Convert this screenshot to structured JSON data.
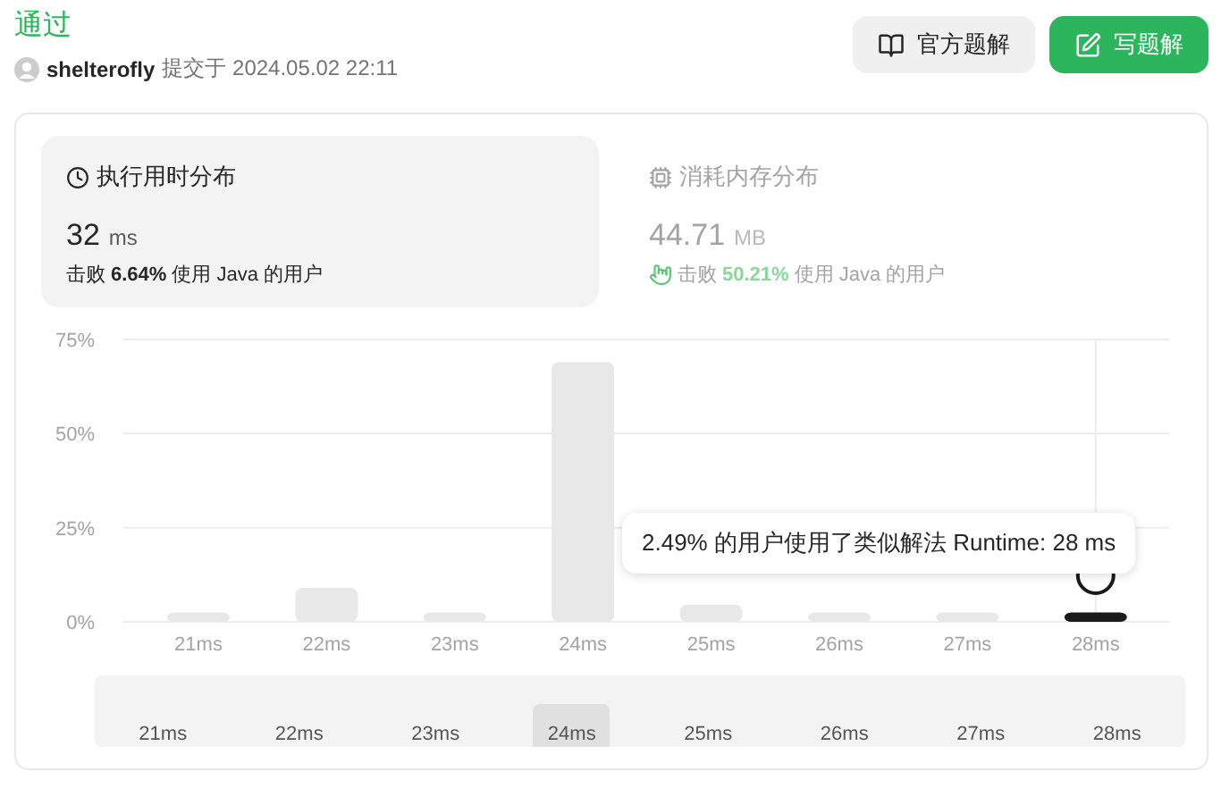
{
  "status": "通过",
  "submission": {
    "user": "shelterofly",
    "submitted_at": "提交于 2024.05.02 22:11"
  },
  "buttons": [
    {
      "label": "官方题解",
      "kind": "secondary"
    },
    {
      "label": "写题解",
      "kind": "primary"
    }
  ],
  "metric_tabs": [
    {
      "title": "执行用时分布",
      "selected": true,
      "kind": "runtime",
      "value": "32",
      "unit": "ms",
      "beats_prefix": "击败",
      "beats": "6.64%",
      "beats_suffix": "使用 Java 的用户"
    },
    {
      "title": "消耗内存分布",
      "selected": false,
      "kind": "memory",
      "value": "44.71",
      "unit": "MB",
      "beats_prefix": "击败",
      "beats": "50.21%",
      "beats_suffix": "使用 Java 的用户"
    }
  ],
  "chart": {
    "chart_data": {
      "type": "bar",
      "categories": [
        "21ms",
        "22ms",
        "23ms",
        "24ms",
        "25ms",
        "26ms",
        "27ms",
        "28ms"
      ],
      "values": [
        2.5,
        9,
        2.5,
        69,
        4.5,
        2.5,
        2.5,
        2.5
      ],
      "ylim": [
        0,
        75
      ],
      "grid": true,
      "yticks": [
        {
          "value": 0,
          "label": "0%"
        },
        {
          "value": 25,
          "label": "25%"
        },
        {
          "value": 50,
          "label": "50%"
        },
        {
          "value": 75,
          "label": "75%"
        }
      ]
    },
    "highlighted": [
      false,
      false,
      false,
      false,
      false,
      false,
      false,
      true
    ],
    "tooltip": "2.49% 的用户使用了类似解法 Runtime: 28 ms"
  },
  "overview": [
    {
      "label": "21ms",
      "selected": false
    },
    {
      "label": "22ms",
      "selected": false
    },
    {
      "label": "23ms",
      "selected": false
    },
    {
      "label": "24ms",
      "selected": true
    },
    {
      "label": "25ms",
      "selected": false
    },
    {
      "label": "26ms",
      "selected": false
    },
    {
      "label": "27ms",
      "selected": false
    },
    {
      "label": "28ms",
      "selected": false
    }
  ]
}
